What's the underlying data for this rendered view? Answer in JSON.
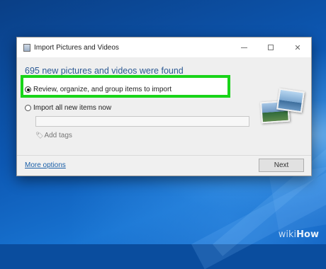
{
  "window": {
    "title": "Import Pictures and Videos",
    "heading": "695 new pictures and videos were found",
    "options": [
      {
        "label": "Review, organize, and group items to import",
        "selected": true
      },
      {
        "label": "Import all new items now",
        "selected": false
      }
    ],
    "add_tags_label": "Add tags",
    "more_options_label": "More options",
    "next_label": "Next"
  },
  "colors": {
    "highlight_border": "#19d419",
    "heading_text": "#2c5a94",
    "link": "#1a5fa8"
  },
  "watermark": {
    "prefix": "wiki",
    "suffix": "How"
  }
}
